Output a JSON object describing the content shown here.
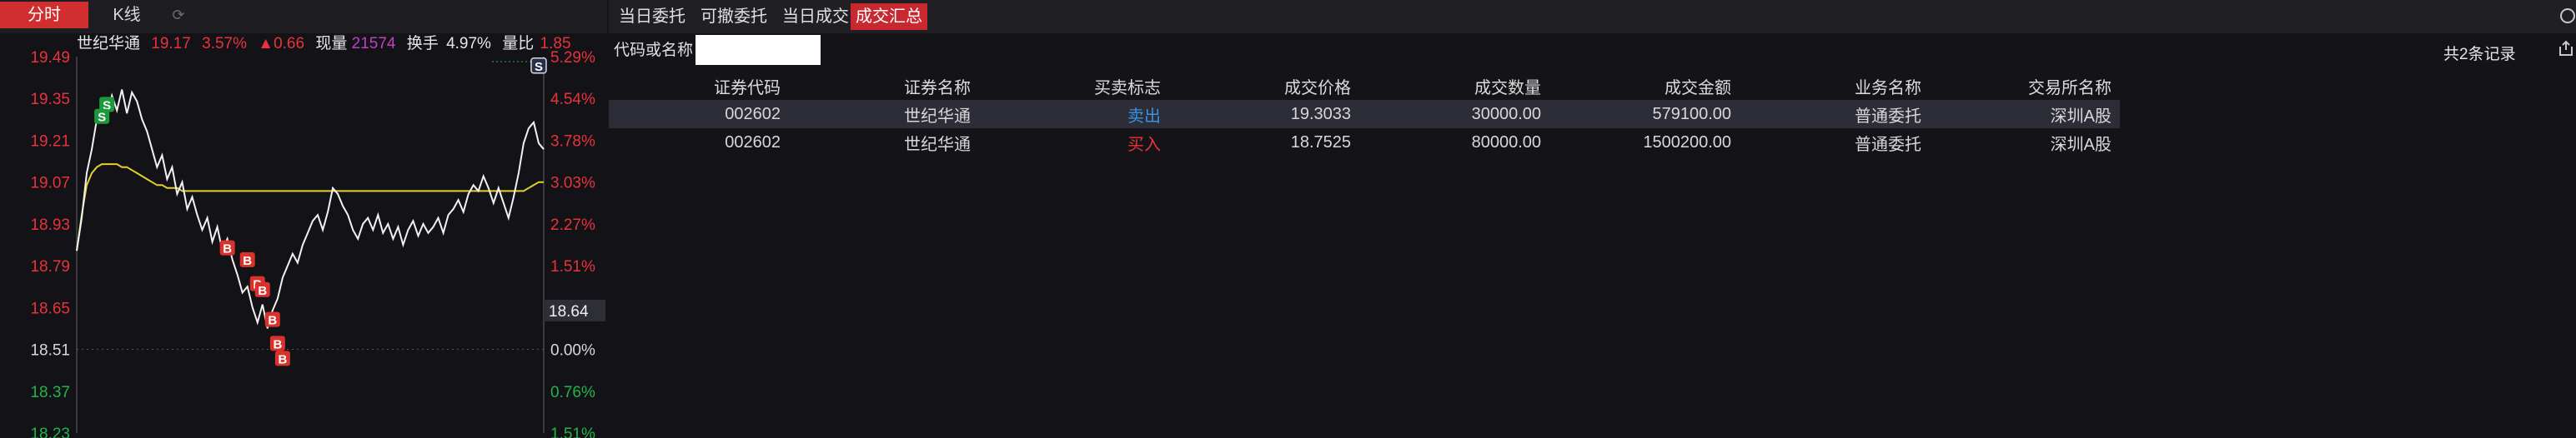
{
  "left_tabs": {
    "intraday": "分时",
    "kline": "K线",
    "refresh_icon": "refresh-icon"
  },
  "quote": {
    "name": "世纪华通",
    "price": "19.17",
    "change_pct": "3.57%",
    "change": "▲0.66",
    "volume_label": "现量",
    "volume": "21574",
    "turnover_label": "换手",
    "turnover": "4.97%",
    "vol_ratio_label": "量比",
    "vol_ratio": "1.85"
  },
  "chart_data": {
    "type": "line",
    "price_ticks": [
      "19.49",
      "19.35",
      "19.21",
      "19.07",
      "18.93",
      "18.79",
      "18.65",
      "18.51",
      "18.37",
      "18.23"
    ],
    "pct_ticks": [
      "5.29%",
      "4.54%",
      "3.78%",
      "3.03%",
      "2.27%",
      "1.51%",
      "0.76%",
      "0.00%",
      "0.76%",
      "1.51%"
    ],
    "current_label": "18.64",
    "pre_close": 18.51,
    "ylim": [
      18.23,
      19.49
    ],
    "price": [
      18.84,
      18.95,
      19.1,
      19.18,
      19.28,
      19.33,
      19.3,
      19.36,
      19.31,
      19.38,
      19.3,
      19.37,
      19.34,
      19.28,
      19.24,
      19.18,
      19.12,
      19.16,
      19.08,
      19.12,
      19.03,
      19.07,
      18.98,
      19.02,
      18.96,
      18.91,
      18.95,
      18.87,
      18.92,
      18.84,
      18.88,
      18.81,
      18.76,
      18.7,
      18.72,
      18.65,
      18.6,
      18.66,
      18.58,
      18.64,
      18.68,
      18.75,
      18.79,
      18.83,
      18.8,
      18.86,
      18.9,
      18.94,
      18.96,
      18.91,
      18.97,
      19.05,
      19.03,
      18.99,
      18.96,
      18.91,
      18.88,
      18.93,
      18.95,
      18.91,
      18.96,
      18.9,
      18.93,
      18.88,
      18.92,
      18.86,
      18.91,
      18.94,
      18.89,
      18.93,
      18.9,
      18.92,
      18.95,
      18.9,
      18.96,
      18.98,
      19.01,
      18.97,
      19.03,
      19.06,
      19.04,
      19.09,
      19.05,
      19.0,
      19.05,
      19.0,
      18.95,
      19.02,
      19.1,
      19.2,
      19.25,
      19.27,
      19.2,
      19.18
    ],
    "avg": [
      18.84,
      18.96,
      19.06,
      19.1,
      19.12,
      19.13,
      19.13,
      19.13,
      19.13,
      19.12,
      19.12,
      19.11,
      19.1,
      19.09,
      19.08,
      19.07,
      19.06,
      19.06,
      19.05,
      19.05,
      19.05,
      19.04,
      19.04,
      19.04,
      19.04,
      19.04,
      19.04,
      19.04,
      19.04,
      19.04,
      19.04,
      19.04,
      19.04,
      19.04,
      19.04,
      19.04,
      19.04,
      19.04,
      19.04,
      19.04,
      19.04,
      19.04,
      19.04,
      19.04,
      19.04,
      19.04,
      19.04,
      19.04,
      19.04,
      19.04,
      19.04,
      19.04,
      19.04,
      19.04,
      19.04,
      19.04,
      19.04,
      19.04,
      19.04,
      19.04,
      19.04,
      19.04,
      19.04,
      19.04,
      19.04,
      19.04,
      19.04,
      19.04,
      19.04,
      19.04,
      19.04,
      19.04,
      19.04,
      19.04,
      19.04,
      19.04,
      19.04,
      19.04,
      19.04,
      19.04,
      19.04,
      19.04,
      19.04,
      19.04,
      19.04,
      19.04,
      19.04,
      19.04,
      19.04,
      19.04,
      19.05,
      19.06,
      19.07,
      19.07
    ],
    "trade_marks": [
      {
        "label": "S",
        "idx": 6,
        "price": 19.33,
        "type": "sell-filled"
      },
      {
        "label": "S",
        "idx": 5,
        "price": 19.29,
        "type": "sell-filled"
      },
      {
        "label": "B",
        "idx": 30,
        "price": 18.85,
        "type": "buy"
      },
      {
        "label": "B",
        "idx": 34,
        "price": 18.81,
        "type": "buy"
      },
      {
        "label": "B",
        "idx": 36,
        "price": 18.73,
        "type": "buy"
      },
      {
        "label": "B",
        "idx": 37,
        "price": 18.71,
        "type": "buy"
      },
      {
        "label": "B",
        "idx": 39,
        "price": 18.61,
        "type": "buy"
      },
      {
        "label": "B",
        "idx": 40,
        "price": 18.53,
        "type": "buy"
      },
      {
        "label": "B",
        "idx": 41,
        "price": 18.48,
        "type": "buy"
      },
      {
        "label": "S",
        "idx": 92,
        "price": 19.46,
        "type": "sell-outline"
      }
    ]
  },
  "right_tabs": [
    "当日委托",
    "可撤委托",
    "当日成交",
    "成交汇总"
  ],
  "active_right_tab": 3,
  "search": {
    "label": "代码或名称",
    "value": "",
    "placeholder": ""
  },
  "record_count": "共2条记录",
  "table": {
    "headers": [
      "证券代码",
      "证券名称",
      "买卖标志",
      "成交价格",
      "成交数量",
      "成交金额",
      "业务名称",
      "交易所名称"
    ],
    "rows": [
      [
        "002602",
        "世纪华通",
        "卖出",
        "19.3033",
        "30000.00",
        "579100.00",
        "普通委托",
        "深圳A股"
      ],
      [
        "002602",
        "世纪华通",
        "买入",
        "18.7525",
        "80000.00",
        "1500200.00",
        "普通委托",
        "深圳A股"
      ]
    ]
  },
  "colors": {
    "accent_red": "#d12f2f",
    "up_red": "#e8323c",
    "down_green": "#1fb54a",
    "avg_line": "#e2d12a",
    "price_line": "#f2f2f2",
    "sell_blue": "#3a8fe6"
  }
}
